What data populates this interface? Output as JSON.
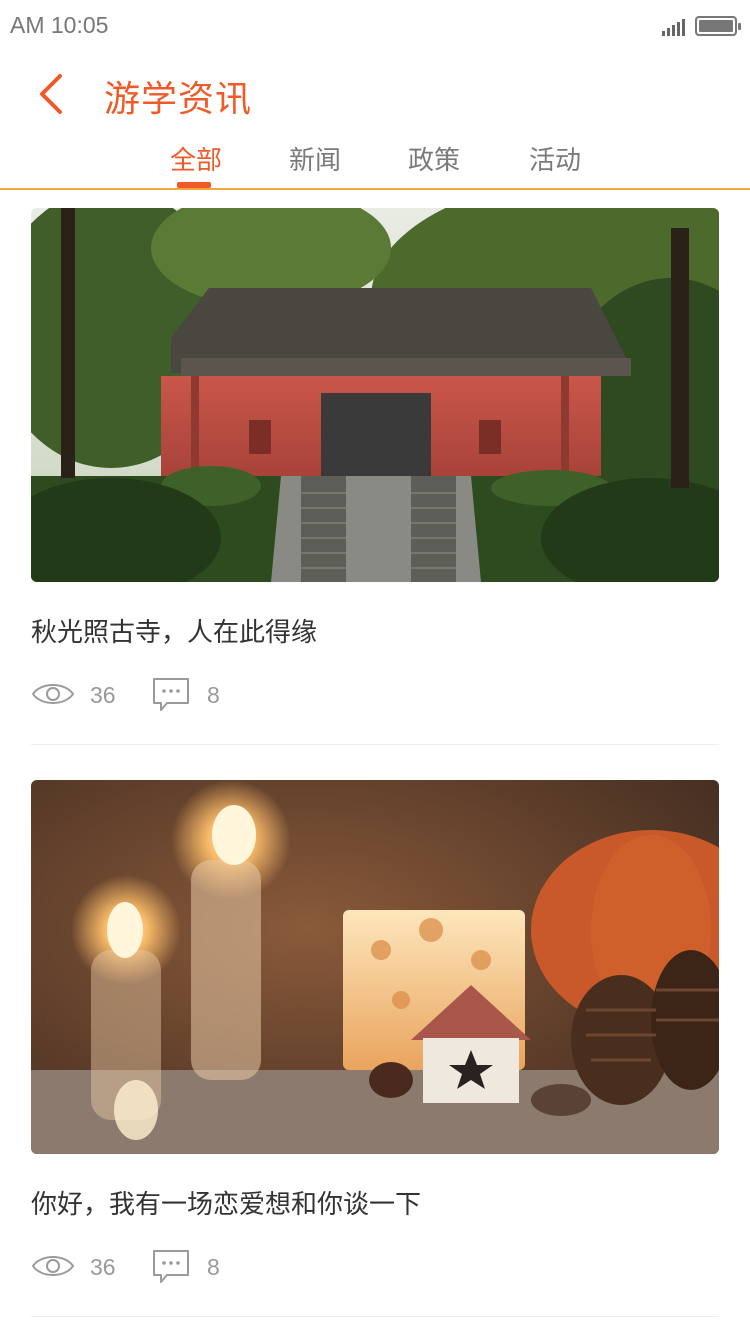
{
  "status": {
    "time": "AM 10:05"
  },
  "header": {
    "title": "游学资讯"
  },
  "tabs": [
    {
      "label": "全部",
      "active": true
    },
    {
      "label": "新闻",
      "active": false
    },
    {
      "label": "政策",
      "active": false
    },
    {
      "label": "活动",
      "active": false
    }
  ],
  "articles": [
    {
      "title": "秋光照古寺，人在此得缘",
      "views": "36",
      "comments": "8",
      "image": "temple-photo"
    },
    {
      "title": "你好，我有一场恋爱想和你谈一下",
      "views": "36",
      "comments": "8",
      "image": "candles-photo"
    }
  ],
  "colors": {
    "accent": "#f05a28",
    "tab_border": "#f3a63a",
    "muted": "#999999"
  }
}
